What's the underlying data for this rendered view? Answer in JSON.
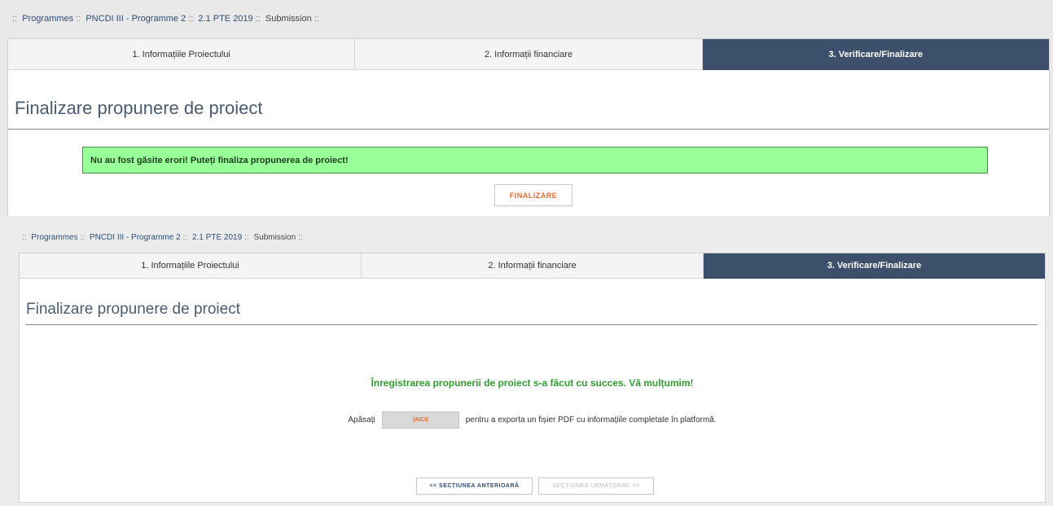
{
  "top": {
    "breadcrumb": [
      {
        "label": "Programmes"
      },
      {
        "label": "PNCDI III - Programme 2"
      },
      {
        "label": "2.1 PTE 2019"
      },
      {
        "label": "Submission"
      }
    ],
    "tabs": [
      {
        "label": "1. Informațiile Proiectului"
      },
      {
        "label": "2. Informații financiare"
      },
      {
        "label": "3. Verificare/Finalizare"
      }
    ],
    "page_title": "Finalizare propunere de proiect",
    "alert_text": "Nu au fost găsite erori! Puteți finaliza propunerea de proiect!",
    "finalize_label": "FINALIZARE"
  },
  "bottom": {
    "breadcrumb": [
      {
        "label": "Programmes"
      },
      {
        "label": "PNCDI III - Programme 2"
      },
      {
        "label": "2.1 PTE 2019"
      },
      {
        "label": "Submission"
      }
    ],
    "tabs": [
      {
        "label": "1. Informațiile Proiectului"
      },
      {
        "label": "2. Informații financiare"
      },
      {
        "label": "3. Verificare/Finalizare"
      }
    ],
    "page_title": "Finalizare propunere de proiect",
    "success_message": "Înregistrarea propunerii de proiect s-a făcut cu succes. Vă mulțumim!",
    "export_prefix": "Apăsați",
    "export_button_label": "(AICI)",
    "export_suffix": "pentru a exporta un fișier PDF cu informațiile completate în platformă.",
    "prev_label": "<< SECȚIUNEA ANTERIOARĂ",
    "next_label": "SECȚIUNEA URMĂTOARE >>"
  },
  "colors": {
    "active_tab": "#3c4f6b",
    "success_bg": "#99ff99",
    "success_text": "#2f9e2f",
    "accent_orange": "#e56a2e",
    "link_blue": "#2d4d7a"
  }
}
